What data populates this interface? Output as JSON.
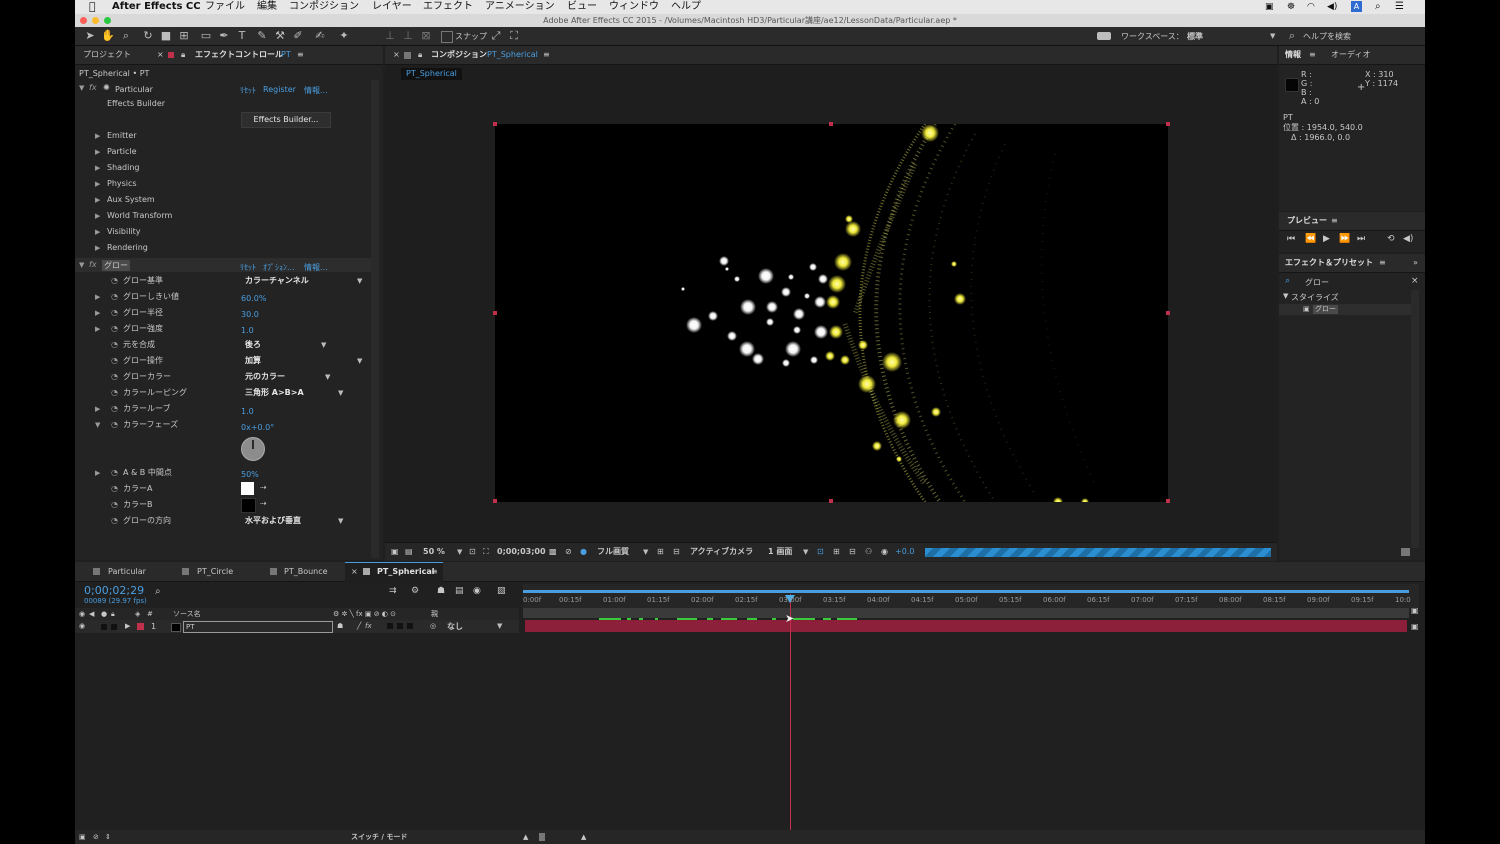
{
  "menubar": {
    "app_name": "After Effects CC",
    "items": [
      "ファイル",
      "編集",
      "コンポジション",
      "レイヤー",
      "エフェクト",
      "アニメーション",
      "ビュー",
      "ウィンドウ",
      "ヘルプ"
    ]
  },
  "window_title": "Adobe After Effects CC 2015 - /Volumes/Macintosh HD3/Particular講座/ae12/LessonData/Particular.aep *",
  "toolbar": {
    "snap_label": "スナップ",
    "workspace_label": "ワークスペース：",
    "workspace_value": "標準",
    "help_search": "ヘルプを検索"
  },
  "project_panel": {
    "tab_project": "プロジェクト",
    "tab_effect_controls": "エフェクトコントロール",
    "tab_effect_controls_layer": "PT",
    "breadcrumb": "PT_Spherical • PT",
    "particular": {
      "name": "Particular",
      "reset": "ﾘｾｯﾄ",
      "register": "Register",
      "info": "情報...",
      "builder_label": "Effects Builder",
      "builder_button": "Effects Builder...",
      "groups": [
        "Emitter",
        "Particle",
        "Shading",
        "Physics",
        "Aux System",
        "World Transform",
        "Visibility",
        "Rendering"
      ]
    },
    "glow": {
      "name": "グロー",
      "reset": "ﾘｾｯﾄ",
      "options": "ｵﾌﾟｼｮﾝ...",
      "info": "情報...",
      "props": [
        {
          "label": "グロー基準",
          "value": "カラーチャンネル",
          "kind": "dropdown"
        },
        {
          "label": "グローしきい値",
          "value": "60.0%",
          "kind": "number"
        },
        {
          "label": "グロー半径",
          "value": "30.0",
          "kind": "number"
        },
        {
          "label": "グロー強度",
          "value": "1.0",
          "kind": "number"
        },
        {
          "label": "元を合成",
          "value": "後ろ",
          "kind": "dropdown"
        },
        {
          "label": "グロー操作",
          "value": "加算",
          "kind": "dropdown"
        },
        {
          "label": "グローカラー",
          "value": "元のカラー",
          "kind": "dropdown"
        },
        {
          "label": "カラールーピング",
          "value": "三角形 A>B>A",
          "kind": "dropdown"
        },
        {
          "label": "カラールーブ",
          "value": "1.0",
          "kind": "number"
        },
        {
          "label": "カラーフェーズ",
          "value": "0x+0.0°",
          "kind": "number"
        },
        {
          "label": "A & B 中間点",
          "value": "50%",
          "kind": "number"
        },
        {
          "label": "カラーA",
          "value": "",
          "kind": "color"
        },
        {
          "label": "カラーB",
          "value": "",
          "kind": "color"
        },
        {
          "label": "グローの方向",
          "value": "水平および垂直",
          "kind": "dropdown"
        }
      ]
    }
  },
  "composition_panel": {
    "tab_label": "コンポジション",
    "comp_name": "PT_Spherical",
    "subtab": "PT_Spherical",
    "footer": {
      "zoom": "50 %",
      "timecode": "0;00;03;00",
      "quality": "フル画質",
      "camera": "アクティブカメラ",
      "views": "1 画面",
      "exposure": "+0.0",
      "render_progress": 1.0
    }
  },
  "info_panel": {
    "tab_info": "情報",
    "tab_audio": "オーディオ",
    "r": "R :",
    "g": "G :",
    "b": "B :",
    "a": "A : 0",
    "x": "X : 310",
    "y": "Y : 1174",
    "layer": "PT",
    "position": "位置 : 1954.0, 540.0",
    "delta": "Δ : 1966.0, 0.0"
  },
  "preview_panel": {
    "title": "プレビュー"
  },
  "effects_presets_panel": {
    "title": "エフェクト＆プリセット",
    "search_value": "グロー",
    "category": "スタイライズ",
    "item": "グロー"
  },
  "timeline": {
    "tabs": [
      "Particular",
      "PT_Circle",
      "PT_Bounce",
      "PT_Spherical"
    ],
    "active_tab": "PT_Spherical",
    "timecode": "0;00;02;29",
    "frame_info": "00089 (29.97 fps)",
    "column_source": "ソース名",
    "column_parent": "親",
    "layer_number": "1",
    "layer_name": "PT",
    "parent_value": "なし",
    "ruler": [
      "0:00f",
      "00:15f",
      "01:00f",
      "01:15f",
      "02:00f",
      "02:15f",
      "03:00f",
      "03:15f",
      "04:00f",
      "04:15f",
      "05:00f",
      "05:15f",
      "06:00f",
      "06:15f",
      "07:00f",
      "07:15f",
      "08:00f",
      "08:15f",
      "09:00f",
      "09:15f",
      "10:0"
    ],
    "switch_mode": "スイッチ / モード"
  },
  "colors": {
    "accent_blue": "#4a9ee0",
    "playhead": "#c0304b",
    "layer_bar": "#8c1f3a",
    "keyframe": "#3acb3a",
    "particle_yellow": "#f5f04a"
  }
}
